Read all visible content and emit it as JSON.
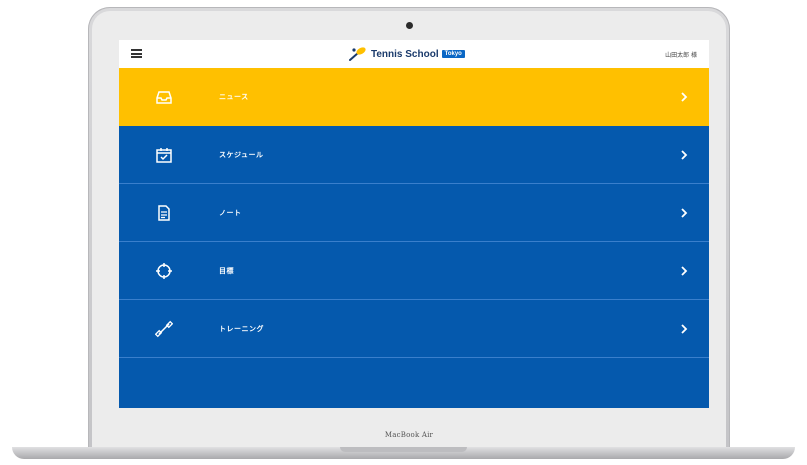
{
  "device": {
    "label": "MacBook Air"
  },
  "header": {
    "brand_title": "Tennis School",
    "brand_badge": "Tokyo",
    "user_name": "山田太郎 様"
  },
  "menu": {
    "items": [
      {
        "label": "ニュース",
        "icon": "inbox-icon",
        "active": true
      },
      {
        "label": "スケジュール",
        "icon": "calendar-check-icon",
        "active": false
      },
      {
        "label": "ノート",
        "icon": "document-icon",
        "active": false
      },
      {
        "label": "目標",
        "icon": "target-icon",
        "active": false
      },
      {
        "label": "トレーニング",
        "icon": "dumbbell-icon",
        "active": false
      }
    ]
  },
  "colors": {
    "primary_blue": "#0559ad",
    "active_yellow": "#ffc000",
    "badge_blue": "#0a67c5"
  }
}
